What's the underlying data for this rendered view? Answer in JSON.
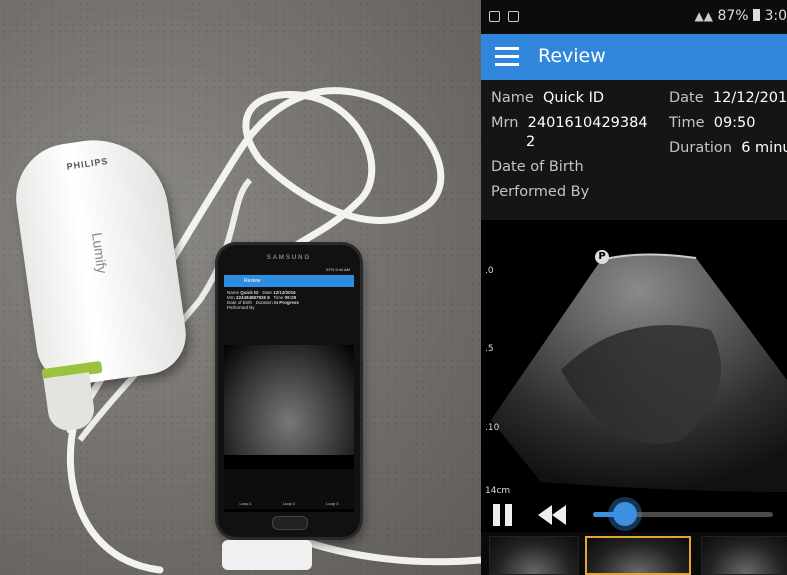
{
  "photo": {
    "probe_brand": "PHILIPS",
    "probe_model": "Lumify",
    "phone_maker": "SAMSUNG",
    "mini_app": {
      "status_text": "67% 9:44 AM",
      "title": "Review",
      "name_label": "Name",
      "name_value": "Quick ID",
      "date_label": "Date",
      "date_value": "12/13/2016",
      "mrn_label": "Mrn",
      "mrn_value": "224494887926 8",
      "time_label": "Time",
      "time_value": "09:29",
      "dob_label": "Date of Birth",
      "duration_label": "Duration",
      "duration_value": "In Progress",
      "performed_label": "Performed By",
      "loops": [
        "Loop 1",
        "Loop 2",
        "Loop 3"
      ]
    }
  },
  "status_bar": {
    "battery": "87%",
    "time": "3:0"
  },
  "header": {
    "title": "Review"
  },
  "patient": {
    "name_label": "Name",
    "name_value": "Quick ID",
    "date_label": "Date",
    "date_value": "12/12/201",
    "mrn_label": "Mrn",
    "mrn_value_line1": "2401610429384",
    "mrn_value_line2": "2",
    "time_label": "Time",
    "time_value": "09:50",
    "duration_label": "Duration",
    "duration_value": "6 minu",
    "dob_label": "Date of Birth",
    "performed_label": "Performed By"
  },
  "image": {
    "orientation_marker": "P",
    "depth_labels": [
      ".0",
      ".5",
      ".10",
      "14cm"
    ]
  },
  "playback": {
    "progress": 0.18
  },
  "colors": {
    "accent": "#2f86db",
    "selected_thumb": "#e3a53a"
  }
}
